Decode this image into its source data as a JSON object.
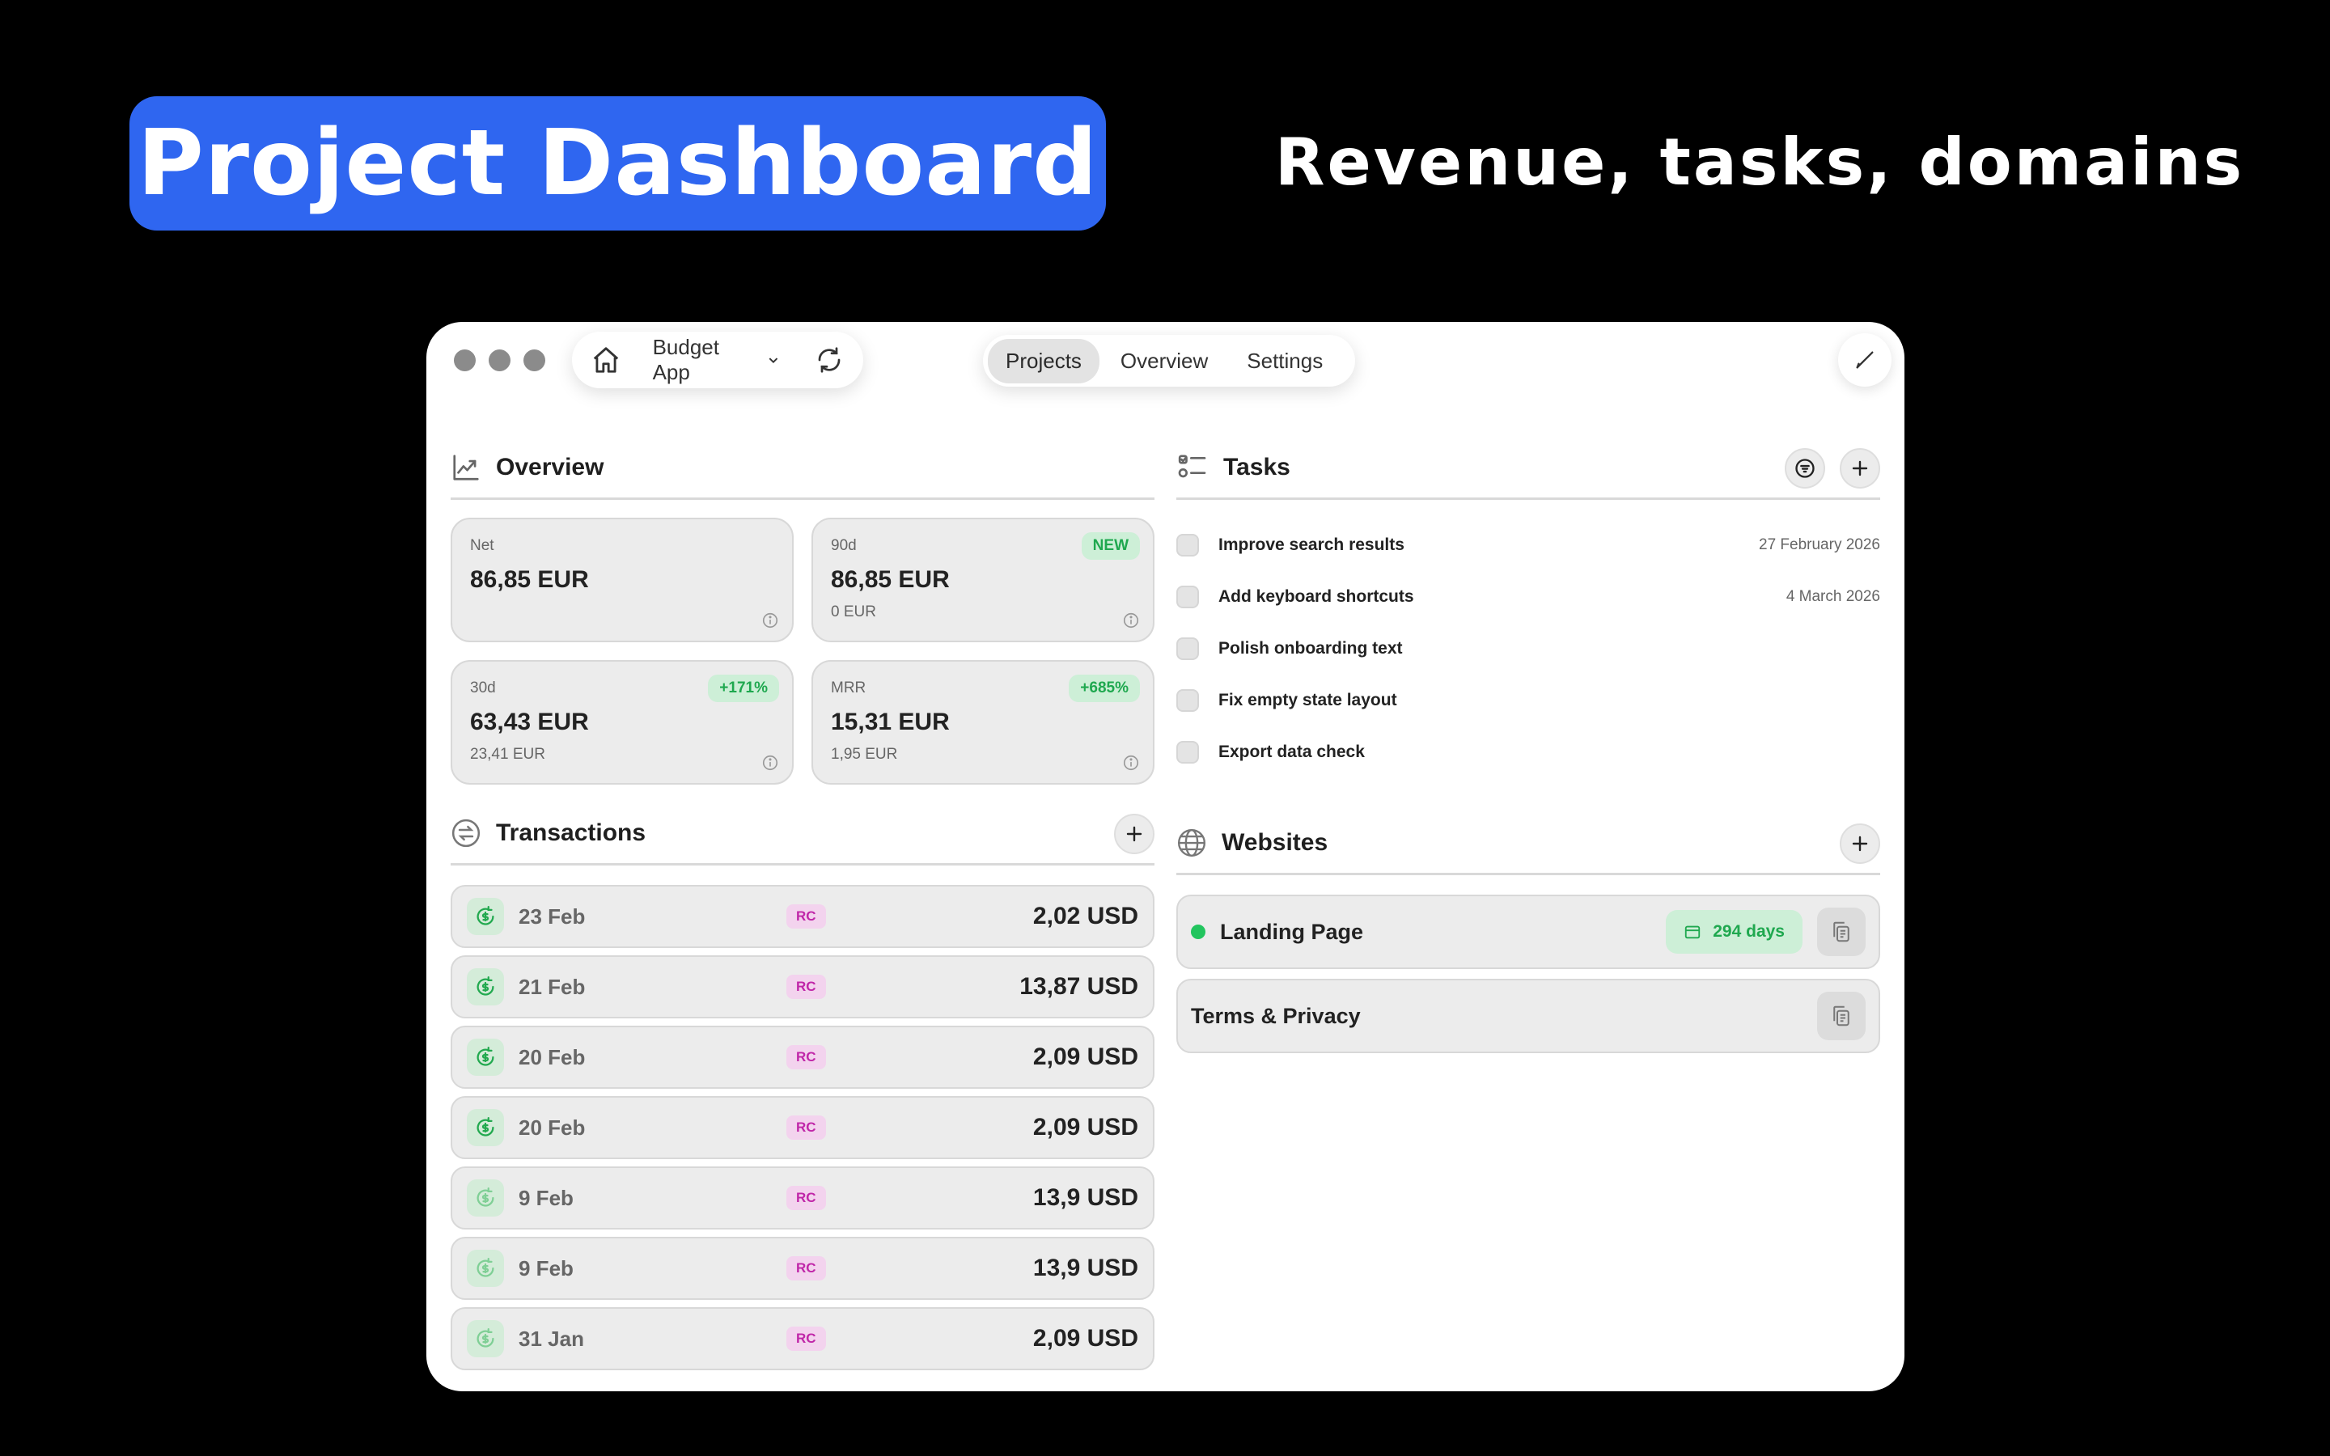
{
  "hero": {
    "title": "Project Dashboard",
    "subtitle": "Revenue, tasks, domains"
  },
  "window": {
    "project_name": "Budget App",
    "tabs": [
      {
        "label": "Projects",
        "active": true
      },
      {
        "label": "Overview",
        "active": false
      },
      {
        "label": "Settings",
        "active": false
      }
    ]
  },
  "overview": {
    "title": "Overview",
    "cards": [
      {
        "label": "Net",
        "value": "86,85 EUR",
        "sub": "",
        "badge": ""
      },
      {
        "label": "90d",
        "value": "86,85 EUR",
        "sub": "0 EUR",
        "badge": "NEW"
      },
      {
        "label": "30d",
        "value": "63,43 EUR",
        "sub": "23,41 EUR",
        "badge": "+171%"
      },
      {
        "label": "MRR",
        "value": "15,31 EUR",
        "sub": "1,95 EUR",
        "badge": "+685%"
      }
    ]
  },
  "transactions": {
    "title": "Transactions",
    "rows": [
      {
        "date": "23 Feb",
        "tag": "RC",
        "amount": "2,02 USD"
      },
      {
        "date": "21 Feb",
        "tag": "RC",
        "amount": "13,87 USD"
      },
      {
        "date": "20 Feb",
        "tag": "RC",
        "amount": "2,09 USD"
      },
      {
        "date": "20 Feb",
        "tag": "RC",
        "amount": "2,09 USD"
      },
      {
        "date": "9 Feb",
        "tag": "RC",
        "amount": "13,9 USD"
      },
      {
        "date": "9 Feb",
        "tag": "RC",
        "amount": "13,9 USD"
      },
      {
        "date": "31 Jan",
        "tag": "RC",
        "amount": "2,09 USD"
      }
    ]
  },
  "tasks": {
    "title": "Tasks",
    "items": [
      {
        "title": "Improve search results",
        "date": "27 February 2026"
      },
      {
        "title": "Add keyboard shortcuts",
        "date": "4 March 2026"
      },
      {
        "title": "Polish onboarding text",
        "date": ""
      },
      {
        "title": "Fix empty state layout",
        "date": ""
      },
      {
        "title": "Export data check",
        "date": ""
      }
    ]
  },
  "websites": {
    "title": "Websites",
    "items": [
      {
        "name": "Landing Page",
        "days": "294 days",
        "status": "online"
      },
      {
        "name": "Terms & Privacy",
        "days": "",
        "status": ""
      }
    ]
  },
  "colors": {
    "hero_blue": "#2f66f0",
    "positive_green": "#1fa84f",
    "tag_magenta": "#c026a8"
  },
  "icons": [
    "home-icon",
    "chevron-down-icon",
    "refresh-icon",
    "pencil-icon",
    "trend-chart-icon",
    "info-icon",
    "exchange-icon",
    "plus-icon",
    "tasks-list-icon",
    "filter-icon",
    "globe-icon",
    "calendar-icon",
    "copy-icon",
    "dollar-refresh-icon"
  ]
}
